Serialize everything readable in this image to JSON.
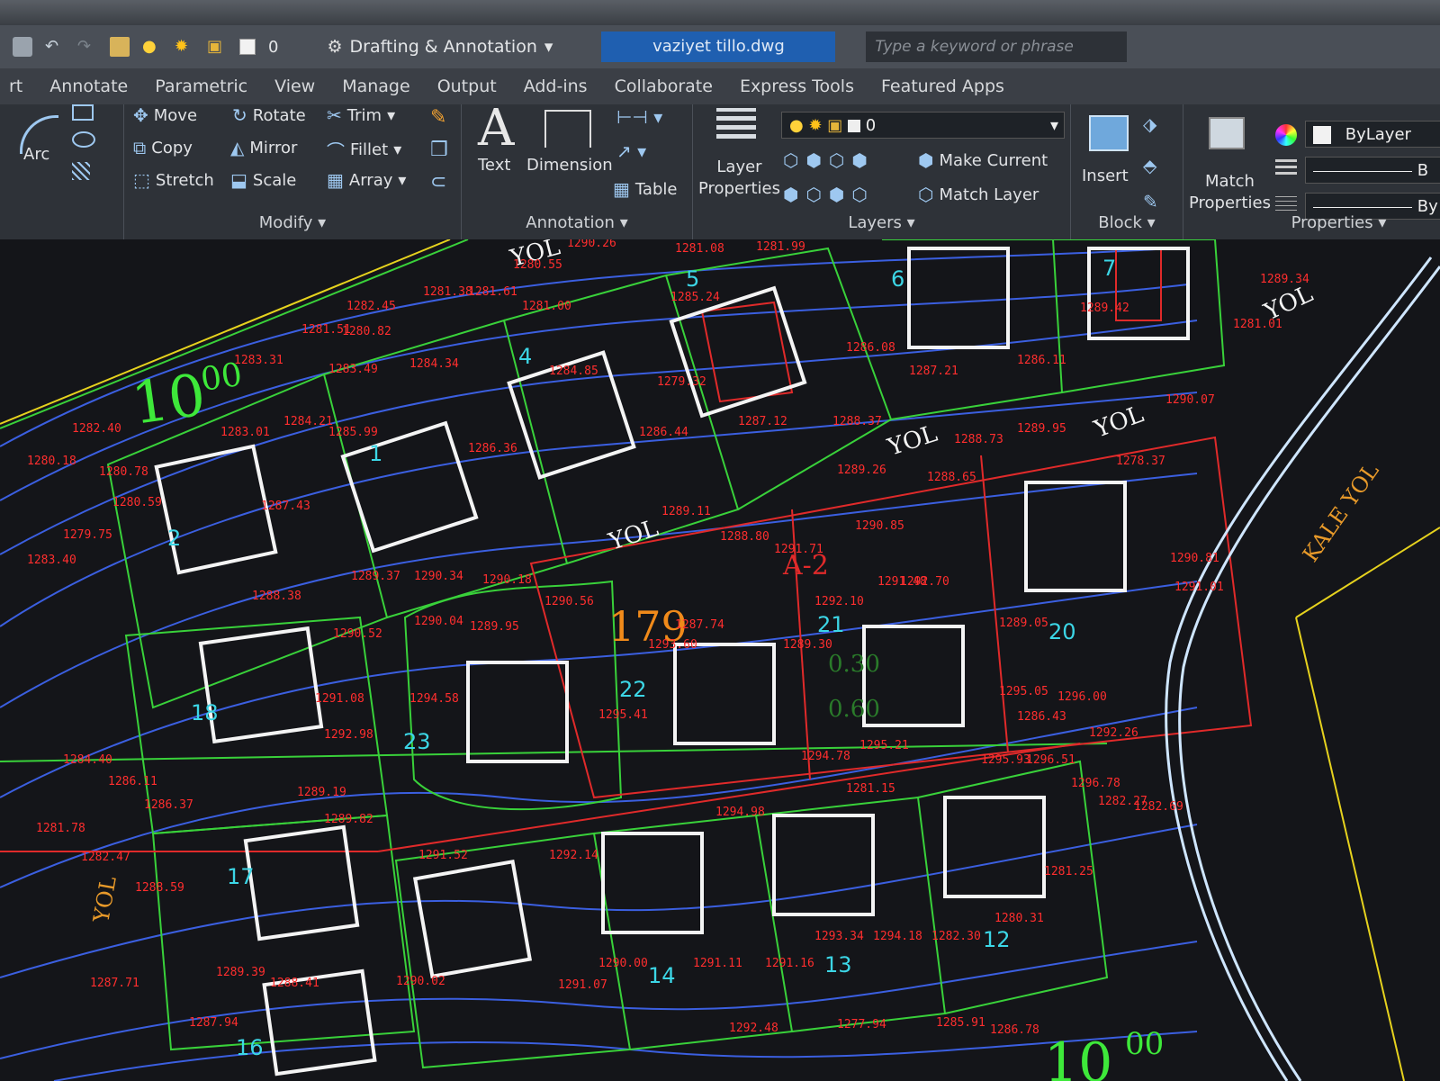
{
  "qat": {
    "layer_value": "0",
    "workspace": "Drafting & Annotation",
    "file_tab": "vaziyet tillo.dwg",
    "search_placeholder": "Type a keyword or phrase"
  },
  "tabs": [
    "rt",
    "Annotate",
    "Parametric",
    "View",
    "Manage",
    "Output",
    "Add-ins",
    "Collaborate",
    "Express Tools",
    "Featured Apps"
  ],
  "ribbon": {
    "draw": {
      "arc": "Arc"
    },
    "modify": {
      "title": "Modify",
      "move": "Move",
      "rotate": "Rotate",
      "trim": "Trim",
      "copy": "Copy",
      "mirror": "Mirror",
      "fillet": "Fillet",
      "stretch": "Stretch",
      "scale": "Scale",
      "array": "Array"
    },
    "annotation": {
      "title": "Annotation",
      "text": "Text",
      "dimension": "Dimension",
      "table": "Table"
    },
    "layers": {
      "title": "Layers",
      "layer_properties_1": "Layer",
      "layer_properties_2": "Properties",
      "current_layer": "0",
      "make_current": "Make Current",
      "match_layer": "Match Layer"
    },
    "block": {
      "title": "Block",
      "insert": "Insert"
    },
    "properties": {
      "title": "Properties",
      "match_1": "Match",
      "match_2": "Properties",
      "bylayer": "ByLayer",
      "by1": "B",
      "by2": "By"
    }
  },
  "drawing": {
    "road_labels": [
      "YOL",
      "YOL",
      "YOL",
      "YOL",
      "YOL",
      "YOL"
    ],
    "kale_yol": "KALE YOL",
    "parcel_block": "179",
    "zone": "A-2",
    "scale_label_main": "10",
    "scale_label_sup": "00",
    "scale_label_bottom_main": "10",
    "scale_label_bottom_sup": "00",
    "lot_numbers": [
      "1",
      "2",
      "4",
      "5",
      "6",
      "7",
      "12",
      "13",
      "14",
      "16",
      "17",
      "18",
      "20",
      "21",
      "22",
      "23"
    ],
    "elevations": [
      "1290.26",
      "1281.08",
      "1281.99",
      "1280.55",
      "1281.38",
      "1281.61",
      "1281.00",
      "1282.45",
      "1285.24",
      "1286.08",
      "1287.21",
      "1286.11",
      "1289.42",
      "1289.34",
      "1281.01",
      "1281.51",
      "1280.82",
      "1283.31",
      "1283.49",
      "1284.34",
      "1284.85",
      "1279.32",
      "1282.40",
      "1283.01",
      "1284.21",
      "1285.99",
      "1286.36",
      "1286.44",
      "1287.12",
      "1288.37",
      "1289.26",
      "1288.65",
      "1288.73",
      "1289.95",
      "1290.07",
      "1278.37",
      "1280.18",
      "1280.78",
      "1280.59",
      "1279.75",
      "1283.40",
      "1287.43",
      "1288.38",
      "1289.11",
      "1288.80",
      "1289.37",
      "1290.34",
      "1290.18",
      "1290.56",
      "1290.04",
      "1289.95",
      "1290.85",
      "1291.71",
      "1291.48",
      "1292.10",
      "1292.70",
      "1290.81",
      "1291.01",
      "1287.74",
      "1293.60",
      "1289.30",
      "1289.05",
      "1290.52",
      "1291.08",
      "1294.58",
      "1295.41",
      "1295.05",
      "1296.00",
      "1286.43",
      "1292.26",
      "1292.98",
      "1294.78",
      "1295.21",
      "1295.93",
      "1296.51",
      "1296.78",
      "1282.27",
      "1282.69",
      "1284.40",
      "1286.11",
      "1286.37",
      "1289.19",
      "1289.82",
      "1291.52",
      "1292.14",
      "1294.98",
      "1281.15",
      "1281.25",
      "1281.78",
      "1282.47",
      "1288.59",
      "1289.39",
      "1290.00",
      "1291.11",
      "1291.16",
      "1293.34",
      "1294.18",
      "1282.30",
      "1280.31",
      "1287.71",
      "1287.94",
      "1288.41",
      "1290.02",
      "1291.07",
      "1292.48",
      "1277.94",
      "1285.91",
      "1286.78"
    ],
    "grade_labels": [
      "0.30",
      "0.60"
    ]
  }
}
